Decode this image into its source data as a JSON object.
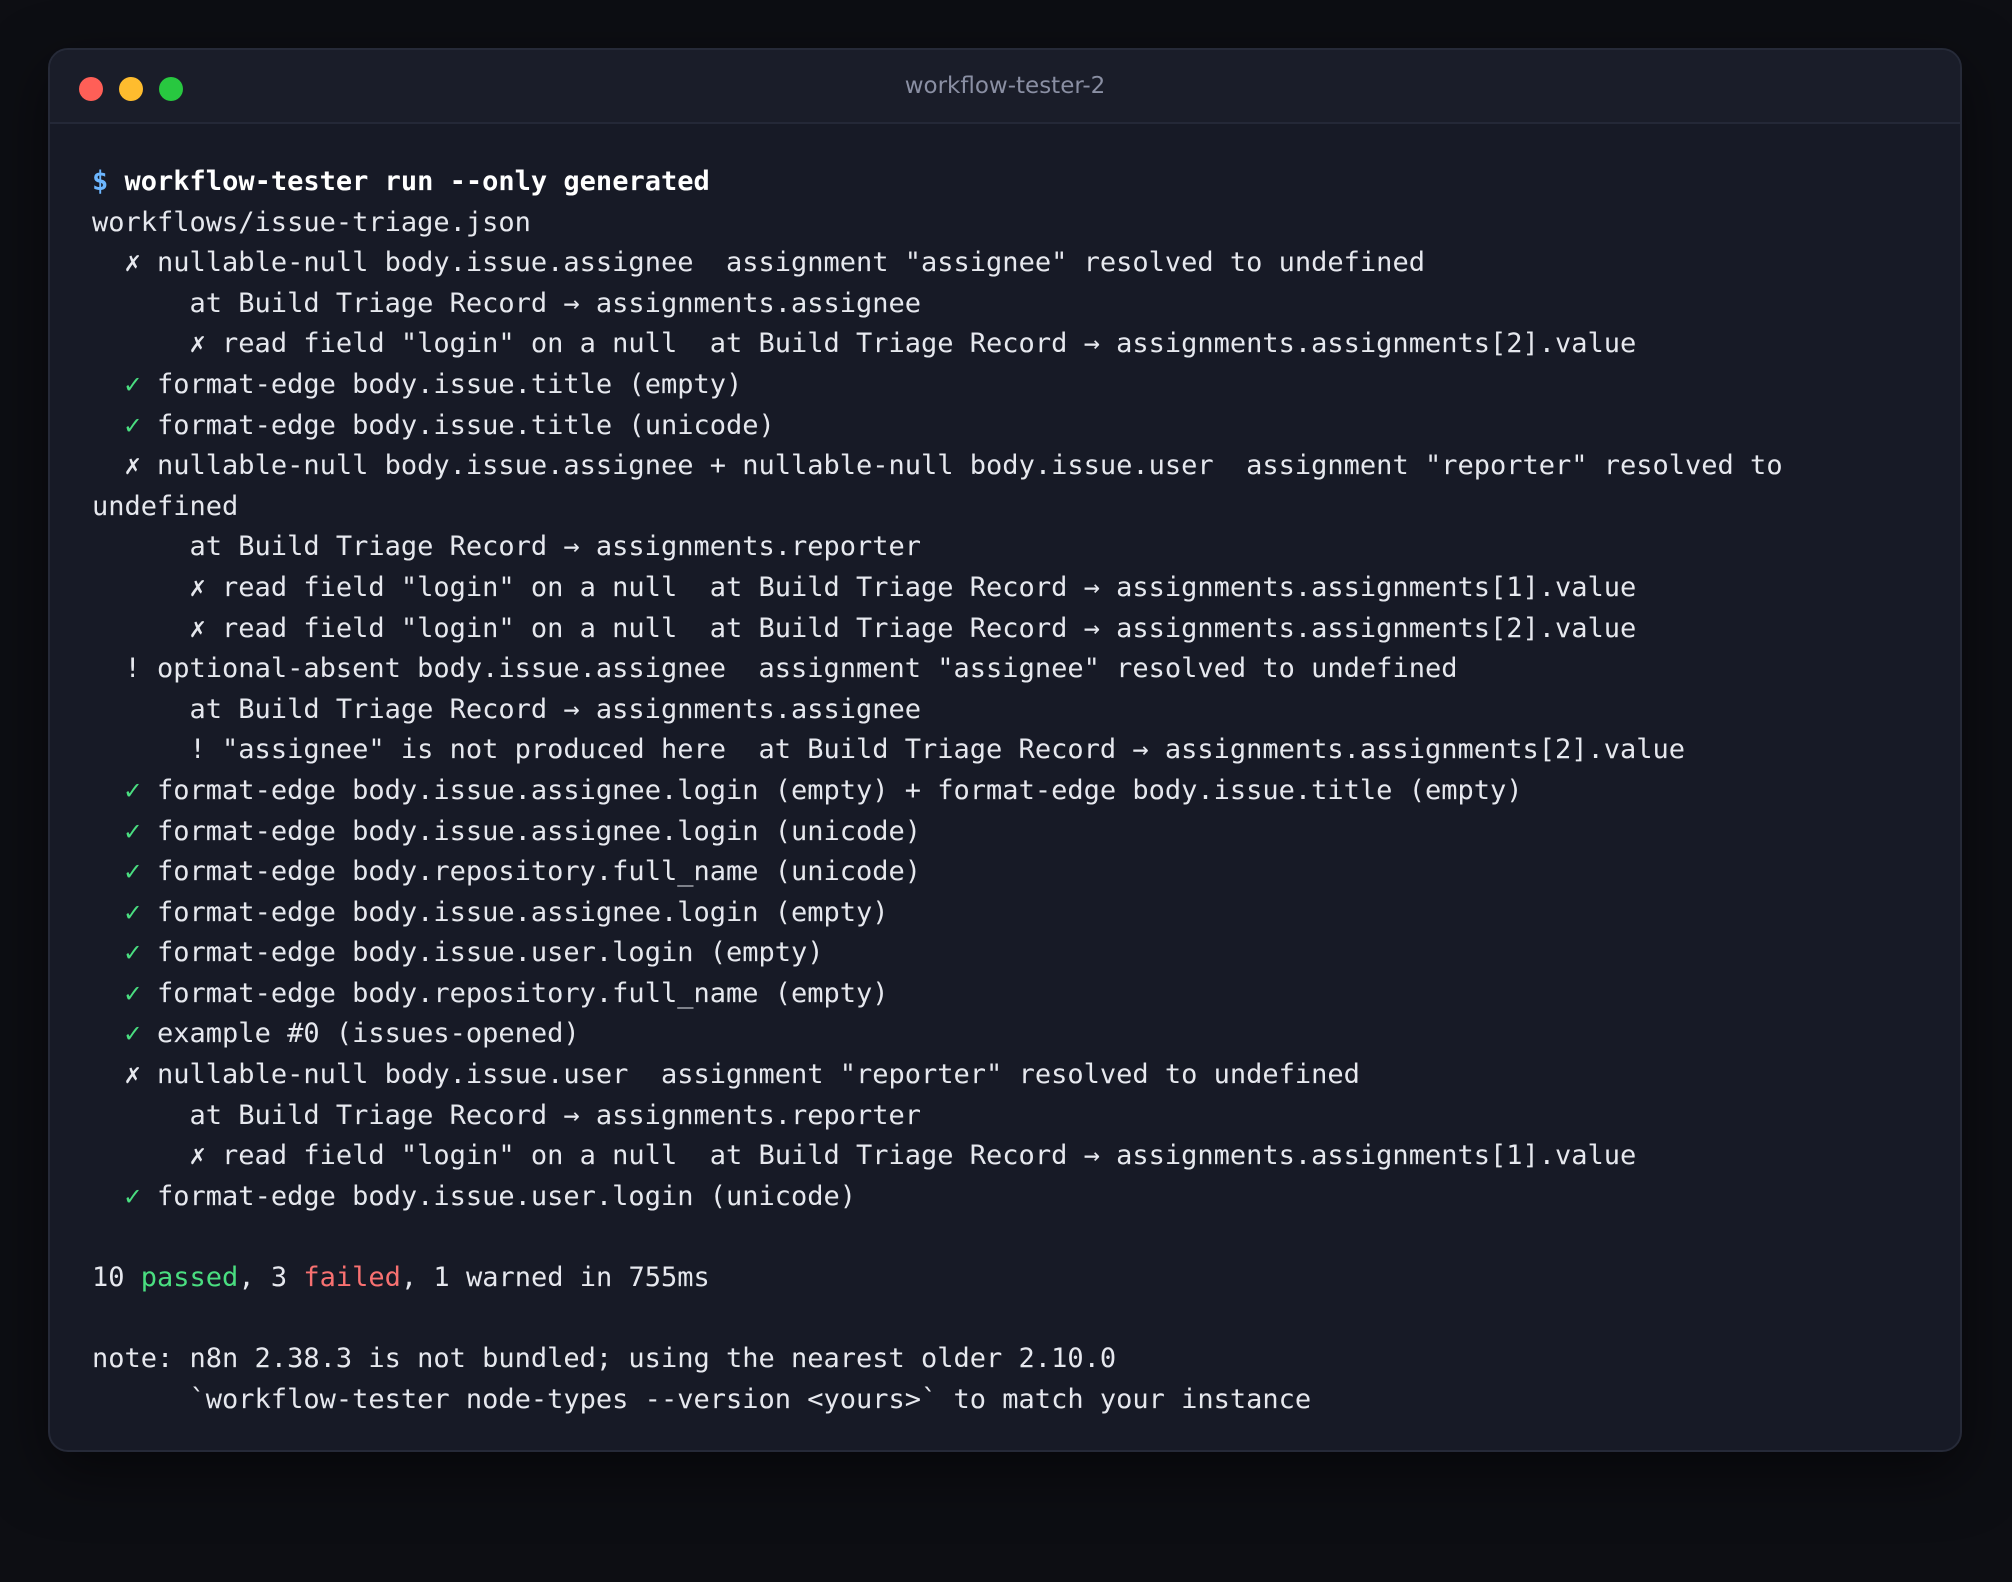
{
  "window": {
    "title": "workflow-tester-2"
  },
  "colors": {
    "background": "#0d0e13",
    "window": "#171a26",
    "prompt": "#6cb6ff",
    "pass": "#4ade80",
    "fail": "#f87171",
    "text": "#e6e8ee"
  },
  "terminal": {
    "prompt_symbol": "$",
    "command": "workflow-tester run --only generated",
    "file": "workflows/issue-triage.json",
    "lines": [
      {
        "mark": "  ✗ ",
        "text": "nullable-null body.issue.assignee  assignment \"assignee\" resolved to undefined"
      },
      {
        "mark": "",
        "text": "      at Build Triage Record → assignments.assignee"
      },
      {
        "mark": "      ✗ ",
        "text": "read field \"login\" on a null  at Build Triage Record → assignments.assignments[2].value"
      },
      {
        "mark": "  ✓ ",
        "text": "format-edge body.issue.title (empty)"
      },
      {
        "mark": "  ✓ ",
        "text": "format-edge body.issue.title (unicode)"
      },
      {
        "mark": "  ✗ ",
        "text": "nullable-null body.issue.assignee + nullable-null body.issue.user  assignment \"reporter\" resolved to"
      },
      {
        "mark": "",
        "text": "undefined"
      },
      {
        "mark": "",
        "text": "      at Build Triage Record → assignments.reporter"
      },
      {
        "mark": "      ✗ ",
        "text": "read field \"login\" on a null  at Build Triage Record → assignments.assignments[1].value"
      },
      {
        "mark": "      ✗ ",
        "text": "read field \"login\" on a null  at Build Triage Record → assignments.assignments[2].value"
      },
      {
        "mark": "  ! ",
        "text": "optional-absent body.issue.assignee  assignment \"assignee\" resolved to undefined"
      },
      {
        "mark": "",
        "text": "      at Build Triage Record → assignments.assignee"
      },
      {
        "mark": "      ! ",
        "text": "\"assignee\" is not produced here  at Build Triage Record → assignments.assignments[2].value"
      },
      {
        "mark": "  ✓ ",
        "text": "format-edge body.issue.assignee.login (empty) + format-edge body.issue.title (empty)"
      },
      {
        "mark": "  ✓ ",
        "text": "format-edge body.issue.assignee.login (unicode)"
      },
      {
        "mark": "  ✓ ",
        "text": "format-edge body.repository.full_name (unicode)"
      },
      {
        "mark": "  ✓ ",
        "text": "format-edge body.issue.assignee.login (empty)"
      },
      {
        "mark": "  ✓ ",
        "text": "format-edge body.issue.user.login (empty)"
      },
      {
        "mark": "  ✓ ",
        "text": "format-edge body.repository.full_name (empty)"
      },
      {
        "mark": "  ✓ ",
        "text": "example #0 (issues-opened)"
      },
      {
        "mark": "  ✗ ",
        "text": "nullable-null body.issue.user  assignment \"reporter\" resolved to undefined"
      },
      {
        "mark": "",
        "text": "      at Build Triage Record → assignments.reporter"
      },
      {
        "mark": "      ✗ ",
        "text": "read field \"login\" on a null  at Build Triage Record → assignments.assignments[1].value"
      },
      {
        "mark": "  ✓ ",
        "text": "format-edge body.issue.user.login (unicode)"
      }
    ],
    "summary": {
      "passed_count": "10",
      "passed_word": "passed",
      "sep1": ", ",
      "failed_count": "3",
      "failed_word": "failed",
      "rest": ", 1 warned in 755ms"
    },
    "note_line1": "note: n8n 2.38.3 is not bundled; using the nearest older 2.10.0",
    "note_line2": "      `workflow-tester node-types --version <yours>` to match your instance"
  }
}
